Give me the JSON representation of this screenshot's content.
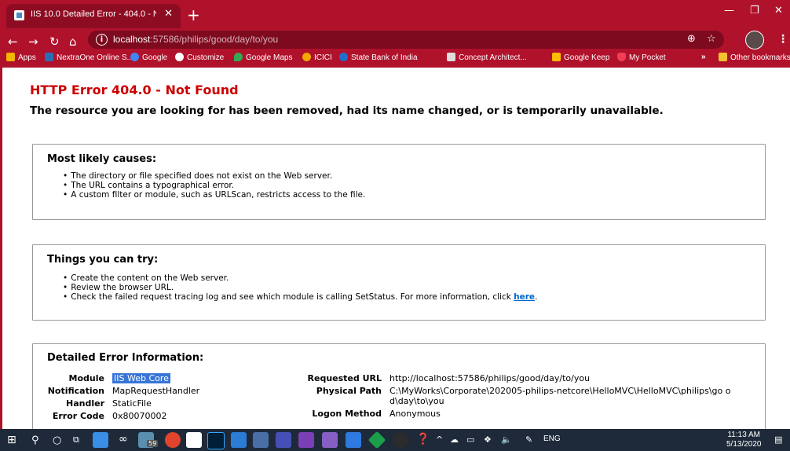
{
  "browser": {
    "tab_title": "IIS 10.0 Detailed Error - 404.0 - N",
    "new_tab": "+",
    "url_host": "localhost",
    "url_rest": ":57586/philips/good/day/to/you",
    "bookmarks": [
      {
        "label": "Apps",
        "color": "#f4b400"
      },
      {
        "label": "NextraOne Online S...",
        "color": "#2a6fb5"
      },
      {
        "label": "Google",
        "color": "#4285f4"
      },
      {
        "label": "Customize",
        "color": "#555555"
      },
      {
        "label": "Google Maps",
        "color": "#34a853"
      },
      {
        "label": "ICICI",
        "color": "#f2a900"
      },
      {
        "label": "State Bank of India",
        "color": "#1f6fcf"
      },
      {
        "label": "Concept Architect...",
        "color": "#777777"
      },
      {
        "label": "Google Keep",
        "color": "#fbbc04"
      },
      {
        "label": "My Pocket",
        "color": "#ef3f56"
      },
      {
        "label": "»",
        "color": ""
      },
      {
        "label": "Other bookmarks",
        "color": "#f4c430"
      }
    ]
  },
  "page": {
    "title": "HTTP Error 404.0 - Not Found",
    "subtitle": "The resource you are looking for has been removed, had its name changed, or is temporarily unavailable.",
    "causes": {
      "heading": "Most likely causes:",
      "items": [
        "The directory or file specified does not exist on the Web server.",
        "The URL contains a typographical error.",
        "A custom filter or module, such as URLScan, restricts access to the file."
      ]
    },
    "tries": {
      "heading": "Things you can try:",
      "items": [
        "Create the content on the Web server.",
        "Review the browser URL."
      ],
      "last_item_text": "Check the failed request tracing log and see which module is calling SetStatus. For more information, click ",
      "last_item_link": "here",
      "last_item_end": "."
    },
    "details": {
      "heading": "Detailed Error Information:",
      "left": [
        {
          "label": "Module",
          "value": "IIS Web Core"
        },
        {
          "label": "Notification",
          "value": "MapRequestHandler"
        },
        {
          "label": "Handler",
          "value": "StaticFile"
        },
        {
          "label": "Error Code",
          "value": "0x80070002"
        }
      ],
      "right": [
        {
          "label": "Requested URL",
          "value": "http://localhost:57586/philips/good/day/to/you"
        },
        {
          "label": "Physical Path",
          "value": "C:\\MyWorks\\Corporate\\202005-philips-netcore\\HelloMVC\\HelloMVC\\philips\\go od\\day\\to\\you"
        },
        {
          "label": "Logon Method",
          "value": "Anonymous"
        }
      ]
    }
  },
  "taskbar": {
    "badge": "59",
    "lang": "ENG",
    "time": "11:13 AM",
    "date": "5/13/2020"
  }
}
